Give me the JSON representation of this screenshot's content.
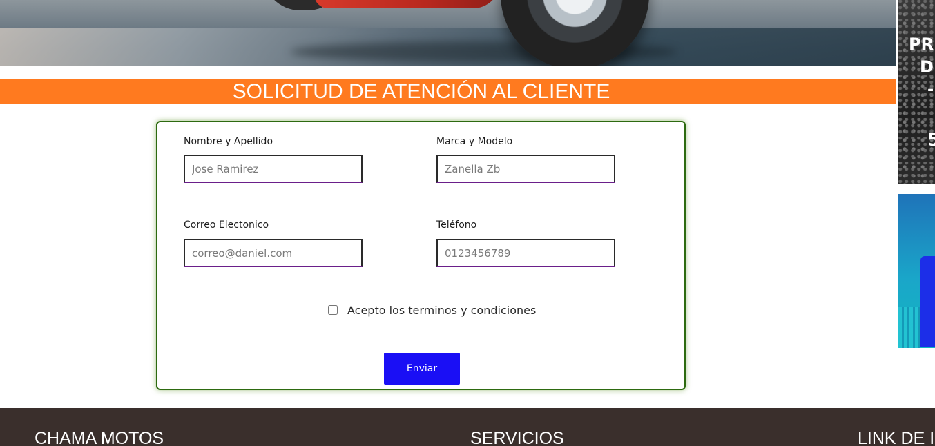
{
  "banner": {
    "title": "SOLICITUD DE ATENCIÓN AL CLIENTE",
    "color": "#ff7a1f"
  },
  "ads": {
    "ad1_text": [
      "PR",
      "D",
      "-",
      "5"
    ],
    "ad1_theme": "dark-asphalt",
    "ad2_theme": "blue-finance-chart"
  },
  "form": {
    "fields": [
      {
        "label": "Nombre y Apellido",
        "placeholder": "Jose Ramirez"
      },
      {
        "label": "Marca y Modelo",
        "placeholder": "Zanella Zb"
      },
      {
        "label": "Correo Electonico",
        "placeholder": "correo@daniel.com"
      },
      {
        "label": "Teléfono",
        "placeholder": "0123456789"
      }
    ],
    "terms_label": "Acepto los terminos y condiciones",
    "submit_label": "Enviar",
    "submit_color": "#1a0ff5",
    "border_color": "#2d6a10"
  },
  "footer": {
    "columns": [
      {
        "title": "CHAMA MOTOS"
      },
      {
        "title": "SERVICIOS"
      },
      {
        "title": "LINK DE I"
      }
    ],
    "background": "#3a2f2c"
  }
}
